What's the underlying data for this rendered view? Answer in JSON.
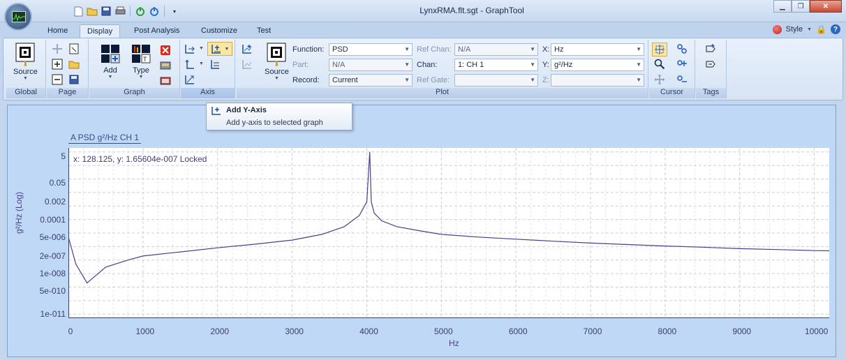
{
  "window": {
    "title": "LynxRMA.flt.sgt - GraphTool"
  },
  "tabs": [
    "Home",
    "Display",
    "Post Analysis",
    "Customize",
    "Test"
  ],
  "active_tab": "Display",
  "style_menu": {
    "label": "Style"
  },
  "ribbon": {
    "global": {
      "label": "Global",
      "source_label": "Source"
    },
    "page": {
      "label": "Page"
    },
    "graph": {
      "label": "Graph",
      "add_label": "Add",
      "type_label": "Type"
    },
    "axis": {
      "label": "Axis"
    },
    "plot": {
      "label": "Plot",
      "source_label": "Source",
      "function_label": "Function:",
      "function_value": "PSD",
      "part_label": "Part:",
      "part_value": "N/A",
      "record_label": "Record:",
      "record_value": "Current",
      "ref_chan_label": "Ref Chan:",
      "ref_chan_value": "N/A",
      "chan_label": "Chan:",
      "chan_value": "1: CH 1",
      "ref_gate_label": "Ref Gate:",
      "ref_gate_value": "",
      "x_label": "X:",
      "x_value": "Hz",
      "y_label": "Y:",
      "y_value": "g²/Hz",
      "z_label": "Z:",
      "z_value": ""
    },
    "cursor": {
      "label": "Cursor"
    },
    "tags": {
      "label": "Tags"
    }
  },
  "tooltip": {
    "title": "Add Y-Axis",
    "description": "Add y-axis to selected graph"
  },
  "graph": {
    "trace_tab": "A PSD g²/Hz CH 1",
    "cursor_readout": "x: 128.125, y: 1.65604e-007 Locked"
  },
  "chart_data": {
    "type": "line",
    "xlabel": "Hz",
    "ylabel": "g²/Hz (Log)",
    "y_scale": "log",
    "x_ticks": [
      "0",
      "1000",
      "2000",
      "3000",
      "4000",
      "5000",
      "6000",
      "7000",
      "8000",
      "9000",
      "10000"
    ],
    "y_ticks": [
      "5",
      "0.05",
      "0.002",
      "0.0001",
      "5e-006",
      "2e-007",
      "1e-008",
      "5e-010",
      "1e-011"
    ],
    "xlim": [
      0,
      10200
    ],
    "grid": true,
    "series": [
      {
        "color": "#4b3c8c",
        "x": [
          0,
          100,
          250,
          500,
          800,
          1000,
          1500,
          2000,
          2500,
          3000,
          3400,
          3700,
          3900,
          4000,
          4040,
          4060,
          4100,
          4200,
          4400,
          4700,
          5000,
          5500,
          6000,
          6500,
          7000,
          7500,
          8000,
          8500,
          9000,
          9500,
          10000,
          10200
        ],
        "y": [
          5e-06,
          5e-08,
          2e-09,
          3e-08,
          1e-07,
          2e-07,
          4e-07,
          8e-07,
          1.5e-06,
          3e-06,
          8e-06,
          3e-05,
          0.0002,
          0.002,
          10,
          0.002,
          0.0003,
          8e-05,
          3e-05,
          1.5e-05,
          8e-06,
          5e-06,
          3.5e-06,
          2.5e-06,
          1.8e-06,
          1.4e-06,
          1.1e-06,
          9e-07,
          7e-07,
          6e-07,
          5e-07,
          4.8e-07
        ]
      }
    ]
  }
}
